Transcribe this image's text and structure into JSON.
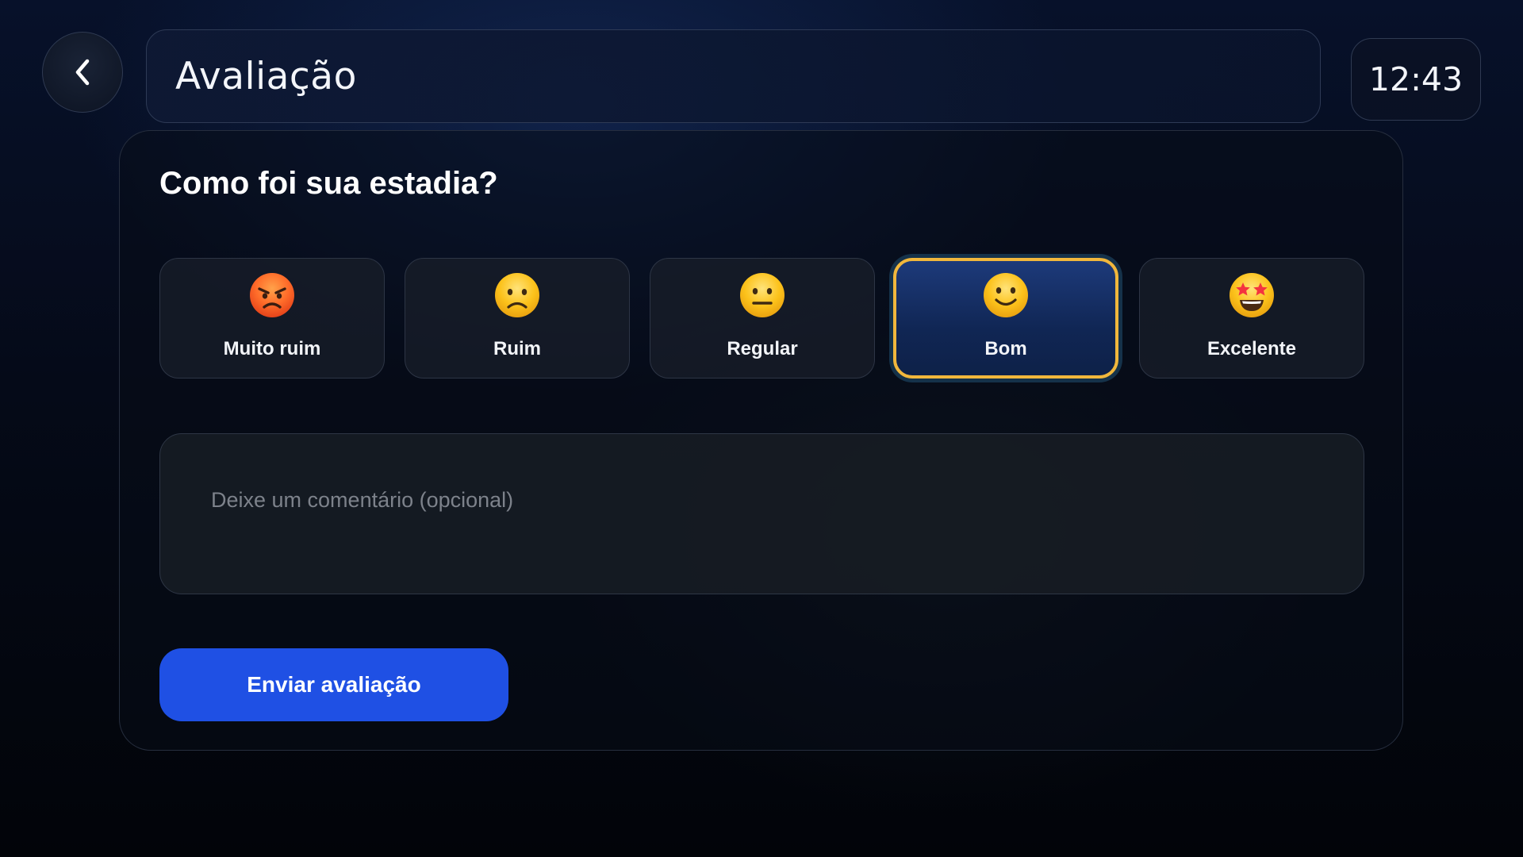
{
  "header": {
    "back_icon": "chevron-left-icon",
    "title": "Avaliação",
    "clock": "12:43"
  },
  "feedback": {
    "question": "Como foi sua estadia?",
    "selected_index": 3,
    "options": [
      {
        "label": "Muito ruim",
        "icon": "angry-face-icon",
        "selected": false
      },
      {
        "label": "Ruim",
        "icon": "frowning-face-icon",
        "selected": false
      },
      {
        "label": "Regular",
        "icon": "neutral-face-icon",
        "selected": false
      },
      {
        "label": "Bom",
        "icon": "slightly-smiling-face-icon",
        "selected": true
      },
      {
        "label": "Excelente",
        "icon": "star-struck-face-icon",
        "selected": false
      }
    ],
    "comment": {
      "value": "",
      "placeholder": "Deixe um comentário (opcional)"
    },
    "submit_label": "Enviar avaliação"
  },
  "colors": {
    "accent_blue": "#1f50e4",
    "selected_border": "#f1b73c",
    "selected_fill": "#1d3a7a",
    "emoji_yellow": "#fcc21b",
    "emoji_angry": "#ff6a26"
  }
}
